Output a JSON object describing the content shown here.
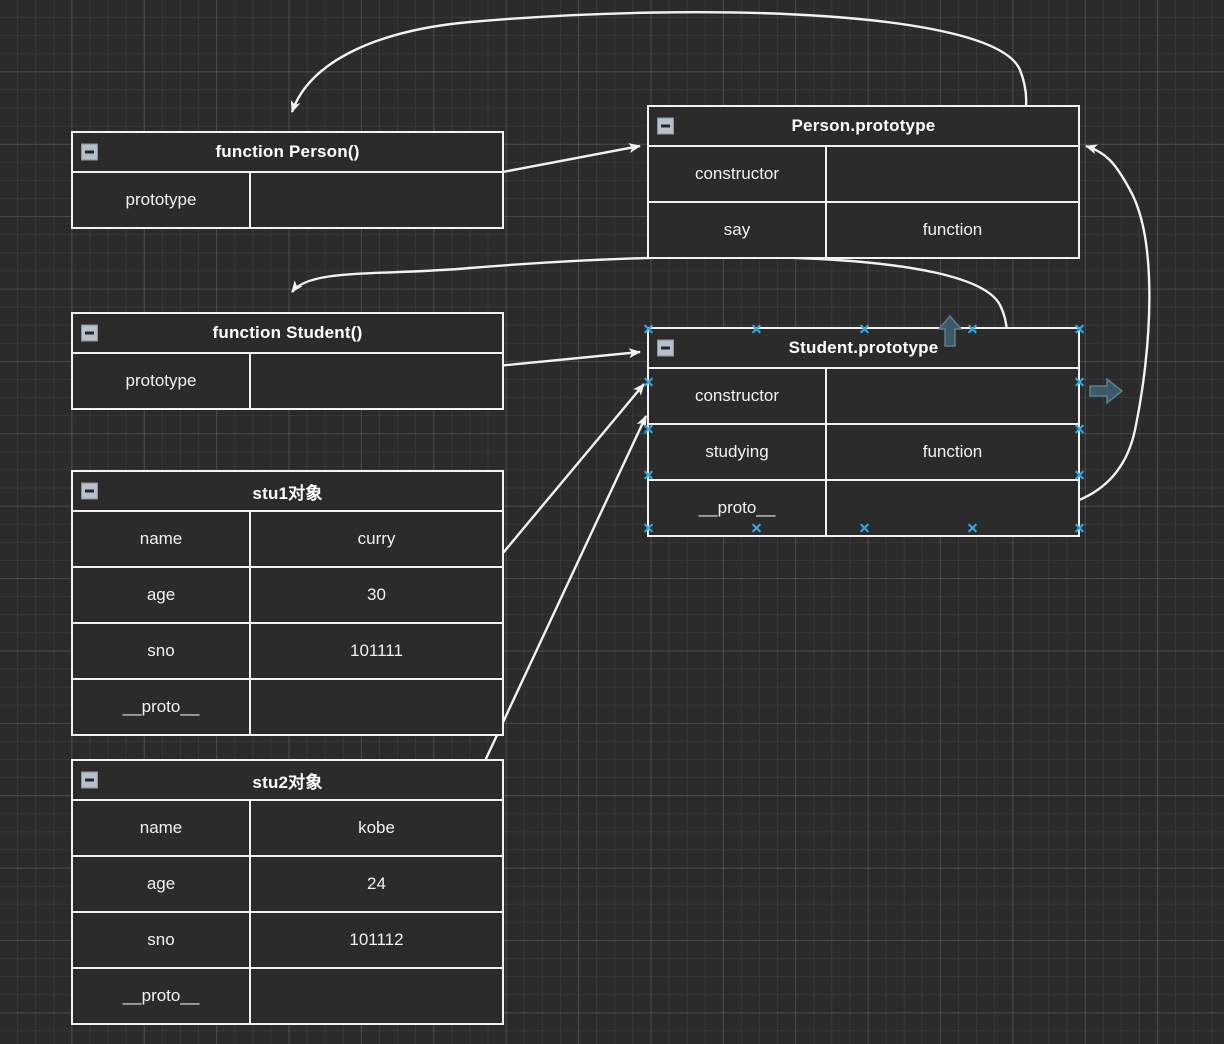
{
  "diagram": {
    "title": "JavaScript prototype chain diagram",
    "background": "#2b2b2b",
    "stroke_color": "#f2f2f2",
    "selection_handle_color": "#2fa8e8",
    "direction_arrow_color": "#3c5a66",
    "collapse_icon": "minus-icon"
  },
  "nodes": [
    {
      "id": "function-person",
      "title": "function Person()",
      "rows": [
        {
          "key": "prototype",
          "value": ""
        }
      ]
    },
    {
      "id": "person-prototype",
      "title": "Person.prototype",
      "rows": [
        {
          "key": "constructor",
          "value": ""
        },
        {
          "key": "say",
          "value": "function"
        }
      ]
    },
    {
      "id": "function-student",
      "title": "function Student()",
      "rows": [
        {
          "key": "prototype",
          "value": ""
        }
      ]
    },
    {
      "id": "student-prototype",
      "title": "Student.prototype",
      "selected": true,
      "rows": [
        {
          "key": "constructor",
          "value": ""
        },
        {
          "key": "studying",
          "value": "function"
        },
        {
          "key": "__proto__",
          "value": ""
        }
      ]
    },
    {
      "id": "stu1",
      "title": "stu1对象",
      "rows": [
        {
          "key": "name",
          "value": "curry"
        },
        {
          "key": "age",
          "value": "30"
        },
        {
          "key": "sno",
          "value": "101111"
        },
        {
          "key": "__proto__",
          "value": ""
        }
      ]
    },
    {
      "id": "stu2",
      "title": "stu2对象",
      "rows": [
        {
          "key": "name",
          "value": "kobe"
        },
        {
          "key": "age",
          "value": "24"
        },
        {
          "key": "sno",
          "value": "101112"
        },
        {
          "key": "__proto__",
          "value": ""
        }
      ]
    }
  ],
  "edges": [
    {
      "id": "person-prototype-to-function-person",
      "from": "person-prototype.constructor",
      "to": "function-person.top",
      "style": "curved"
    },
    {
      "id": "function-person-prototype-to-person-prototype",
      "from": "function-person.prototype",
      "to": "person-prototype.left",
      "style": "straight"
    },
    {
      "id": "student-prototype-constructor-to-function-student",
      "from": "student-prototype.constructor",
      "to": "function-student.top",
      "style": "curved"
    },
    {
      "id": "function-student-prototype-to-student-prototype",
      "from": "function-student.prototype",
      "to": "student-prototype.left",
      "style": "straight"
    },
    {
      "id": "student-prototype-proto-to-person-prototype",
      "from": "student-prototype.__proto__",
      "to": "person-prototype.right",
      "style": "curved"
    },
    {
      "id": "stu1-proto-to-student-prototype",
      "from": "stu1.__proto__",
      "to": "student-prototype.left",
      "style": "straight"
    },
    {
      "id": "stu2-proto-to-student-prototype",
      "from": "stu2.__proto__",
      "to": "student-prototype.left",
      "style": "straight"
    }
  ],
  "direction_arrows": [
    {
      "id": "arrow-up",
      "direction": "up"
    },
    {
      "id": "arrow-right",
      "direction": "right"
    }
  ]
}
